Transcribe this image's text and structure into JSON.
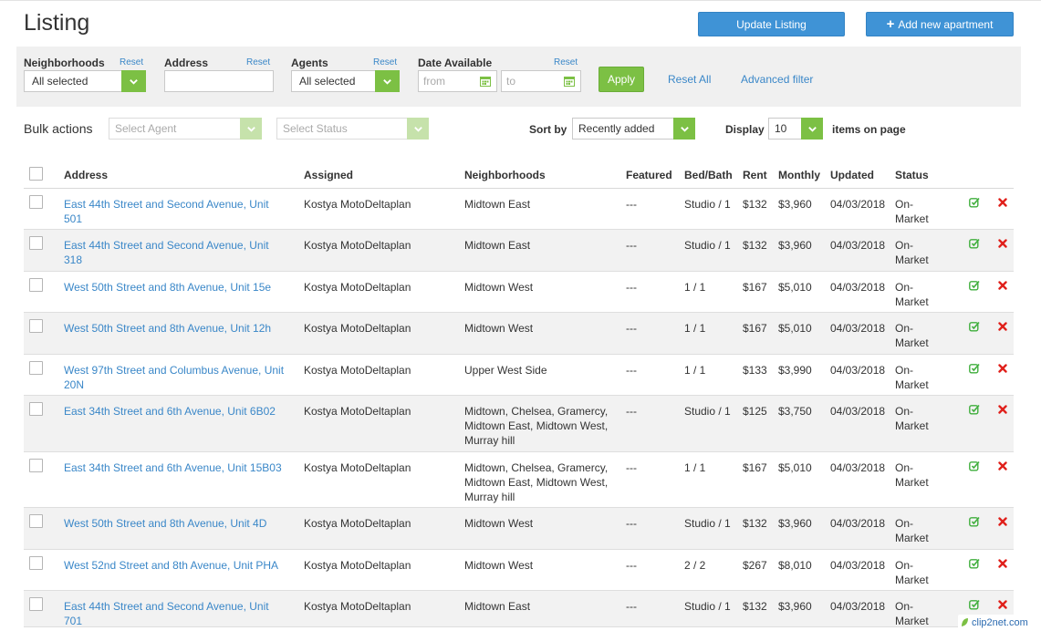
{
  "page": {
    "title": "Listing"
  },
  "header": {
    "update_label": "Update Listing",
    "add_label": "Add new apartment"
  },
  "filters": {
    "neighborhoods": {
      "label": "Neighborhoods",
      "reset": "Reset",
      "value": "All selected"
    },
    "address": {
      "label": "Address",
      "reset": "Reset",
      "value": ""
    },
    "agents": {
      "label": "Agents",
      "reset": "Reset",
      "value": "All selected"
    },
    "date": {
      "label": "Date Available",
      "reset": "Reset",
      "from_placeholder": "from",
      "to_placeholder": "to"
    },
    "apply_label": "Apply",
    "reset_all_label": "Reset All",
    "advanced_label": "Advanced filter"
  },
  "bulk": {
    "label": "Bulk actions",
    "agent_placeholder": "Select Agent",
    "status_placeholder": "Select Status"
  },
  "sort": {
    "label": "Sort by",
    "value": "Recently added"
  },
  "display": {
    "label": "Display",
    "value": "10",
    "suffix": "items on page"
  },
  "columns": {
    "address": "Address",
    "assigned": "Assigned",
    "neighborhoods": "Neighborhoods",
    "featured": "Featured",
    "bedbath": "Bed/Bath",
    "rent": "Rent",
    "monthly": "Monthly",
    "updated": "Updated",
    "status": "Status"
  },
  "rows": [
    {
      "address": "East 44th Street and Second Avenue, Unit 501",
      "assigned": "Kostya MotoDeltaplan",
      "neighborhoods": "Midtown East",
      "featured": "---",
      "bedbath": "Studio / 1",
      "rent": "$132",
      "monthly": "$3,960",
      "updated": "04/03/2018",
      "status": "On-Market"
    },
    {
      "address": "East 44th Street and Second Avenue, Unit 318",
      "assigned": "Kostya MotoDeltaplan",
      "neighborhoods": "Midtown East",
      "featured": "---",
      "bedbath": "Studio / 1",
      "rent": "$132",
      "monthly": "$3,960",
      "updated": "04/03/2018",
      "status": "On-Market"
    },
    {
      "address": "West 50th Street and 8th Avenue, Unit 15e",
      "assigned": "Kostya MotoDeltaplan",
      "neighborhoods": "Midtown West",
      "featured": "---",
      "bedbath": "1 / 1",
      "rent": "$167",
      "monthly": "$5,010",
      "updated": "04/03/2018",
      "status": "On-Market"
    },
    {
      "address": "West 50th Street and 8th Avenue, Unit 12h",
      "assigned": "Kostya MotoDeltaplan",
      "neighborhoods": "Midtown West",
      "featured": "---",
      "bedbath": "1 / 1",
      "rent": "$167",
      "monthly": "$5,010",
      "updated": "04/03/2018",
      "status": "On-Market"
    },
    {
      "address": "West 97th Street and Columbus Avenue, Unit 20N",
      "assigned": "Kostya MotoDeltaplan",
      "neighborhoods": "Upper West Side",
      "featured": "---",
      "bedbath": "1 / 1",
      "rent": "$133",
      "monthly": "$3,990",
      "updated": "04/03/2018",
      "status": "On-Market"
    },
    {
      "address": "East 34th Street and 6th Avenue, Unit 6B02",
      "assigned": "Kostya MotoDeltaplan",
      "neighborhoods": "Midtown, Chelsea, Gramercy, Midtown East, Midtown West, Murray hill",
      "featured": "---",
      "bedbath": "Studio / 1",
      "rent": "$125",
      "monthly": "$3,750",
      "updated": "04/03/2018",
      "status": "On-Market"
    },
    {
      "address": "East 34th Street and 6th Avenue, Unit 15B03",
      "assigned": "Kostya MotoDeltaplan",
      "neighborhoods": "Midtown, Chelsea, Gramercy, Midtown East, Midtown West, Murray hill",
      "featured": "---",
      "bedbath": "1 / 1",
      "rent": "$167",
      "monthly": "$5,010",
      "updated": "04/03/2018",
      "status": "On-Market"
    },
    {
      "address": "West 50th Street and 8th Avenue, Unit 4D",
      "assigned": "Kostya MotoDeltaplan",
      "neighborhoods": "Midtown West",
      "featured": "---",
      "bedbath": "Studio / 1",
      "rent": "$132",
      "monthly": "$3,960",
      "updated": "04/03/2018",
      "status": "On-Market"
    },
    {
      "address": "West 52nd Street and 8th Avenue, Unit PHA",
      "assigned": "Kostya MotoDeltaplan",
      "neighborhoods": "Midtown West",
      "featured": "---",
      "bedbath": "2 / 2",
      "rent": "$267",
      "monthly": "$8,010",
      "updated": "04/03/2018",
      "status": "On-Market"
    },
    {
      "address": "East 44th Street and Second Avenue, Unit 701",
      "assigned": "Kostya MotoDeltaplan",
      "neighborhoods": "Midtown East",
      "featured": "---",
      "bedbath": "Studio / 1",
      "rent": "$132",
      "monthly": "$3,960",
      "updated": "04/03/2018",
      "status": "On-Market"
    }
  ],
  "watermark": "clip2net.com",
  "colors": {
    "primary": "#3f93d6",
    "accent": "#7cc044",
    "link": "#3a87c8",
    "delete": "#e0201b"
  }
}
